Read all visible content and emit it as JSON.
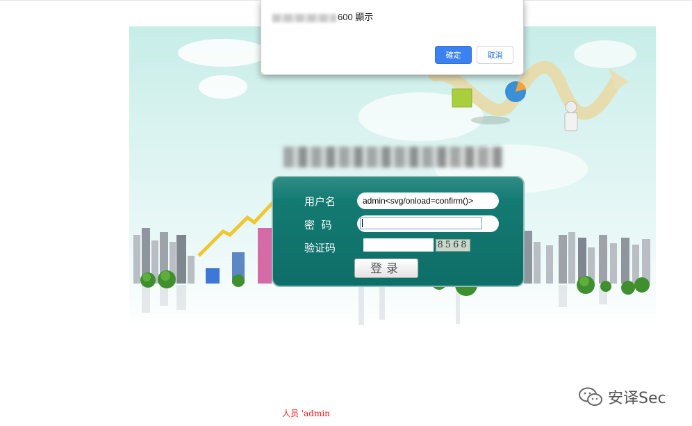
{
  "dialog": {
    "message": "600 顯示",
    "ok_label": "確定",
    "cancel_label": "取消"
  },
  "login": {
    "username_label": "用户名",
    "username_value": "admin<svg/onload=confirm()>",
    "password_label": "密  码",
    "password_value": "",
    "captcha_label": "验证码",
    "captcha_value": "",
    "captcha_code": "8568",
    "submit_label": "登录"
  },
  "footer": {
    "text": "人员 'admin"
  },
  "watermark": {
    "text": "安译Sec",
    "icon": "wechat-icon"
  },
  "colors": {
    "panel_bg": "#0e6e68",
    "dialog_ok": "#3b82f0",
    "footer_text": "#ff1a1a"
  }
}
